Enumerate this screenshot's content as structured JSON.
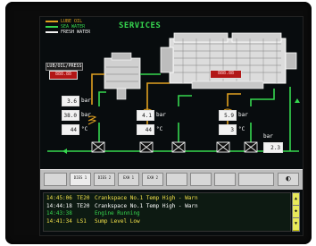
{
  "legend": [
    {
      "label": "LUBE OIL",
      "color": "#e0a020"
    },
    {
      "label": "SEA WATER",
      "color": "#36d84f"
    },
    {
      "label": "FRESH WATER",
      "color": "#f0f0f0"
    }
  ],
  "title": "SERVICES",
  "left_plate": {
    "label": "LUB/OIL/PRESS",
    "value": "888.88"
  },
  "engine_plate": {
    "value": "888.88"
  },
  "readings": [
    {
      "value": "3.6",
      "unit": "bar"
    },
    {
      "value": "38.0",
      "unit": "bar"
    },
    {
      "value": "44",
      "unit": "°C"
    },
    {
      "value": "4.1",
      "unit": "bar"
    },
    {
      "value": "44",
      "unit": "°C"
    },
    {
      "value": "5.9",
      "unit": "bar"
    },
    {
      "value": "3",
      "unit": "°C"
    },
    {
      "value": "2.3",
      "unit": "bar"
    }
  ],
  "toolbar": {
    "buttons": [
      "",
      "DIES 1",
      "DIES 2",
      "EXH 1",
      "EXH 2",
      "",
      "",
      "",
      ""
    ],
    "active_index": 1
  },
  "alarms": [
    {
      "time": "14:45:06",
      "tag": "TE20",
      "text": "Crankspace No.1 Temp High - Warn",
      "color": "#f2e14a"
    },
    {
      "time": "14:44:18",
      "tag": "TE20",
      "text": "Crankspace No.1 Temp High - Warn",
      "color": "#ffffff"
    },
    {
      "time": "14:43:38",
      "tag": "",
      "text": "Engine Running",
      "color": "#36d84f"
    },
    {
      "time": "14:41:34",
      "tag": "LS1",
      "text": "Sump Level Low",
      "color": "#f2e14a"
    }
  ],
  "scrollbar": {
    "up": "▲",
    "mid": "◆",
    "down": "▼"
  }
}
